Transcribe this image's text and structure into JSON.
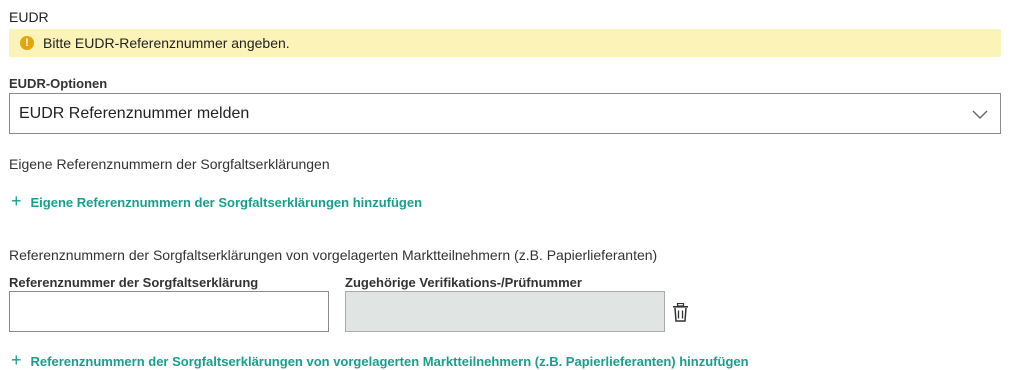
{
  "section": {
    "title": "EUDR"
  },
  "warning": {
    "icon": "warning-circle-icon",
    "text": "Bitte EUDR-Referenznummer angeben."
  },
  "options": {
    "label": "EUDR-Optionen",
    "selected": "EUDR Referenznummer melden",
    "icon": "chevron-down-icon"
  },
  "own_refs": {
    "label": "Eigene Referenznummern der Sorgfaltserklärungen",
    "add_plus": "+",
    "add_label": "Eigene Referenznummern der Sorgfaltserklärungen hinzufügen"
  },
  "upstream_refs": {
    "label": "Referenznummern der Sorgfaltserklärungen von vorgelagerten Marktteilnehmern (z.B. Papierlieferanten)",
    "col_ref": "Referenznummer der Sorgfaltserklärung",
    "col_verif": "Zugehörige Verifikations-/Prüfnummer",
    "ref_value": "",
    "verif_value": "",
    "delete_icon": "trash-icon",
    "add_plus": "+",
    "add_label": "Referenznummern der Sorgfaltserklärungen von vorgelagerten Marktteilnehmern (z.B. Papierlieferanten) hinzufügen"
  },
  "colors": {
    "accent": "#1a9e8c",
    "warning_bg": "#fbf3b8",
    "warning_icon": "#e3a50d",
    "disabled_field": "#e0e4e3"
  }
}
